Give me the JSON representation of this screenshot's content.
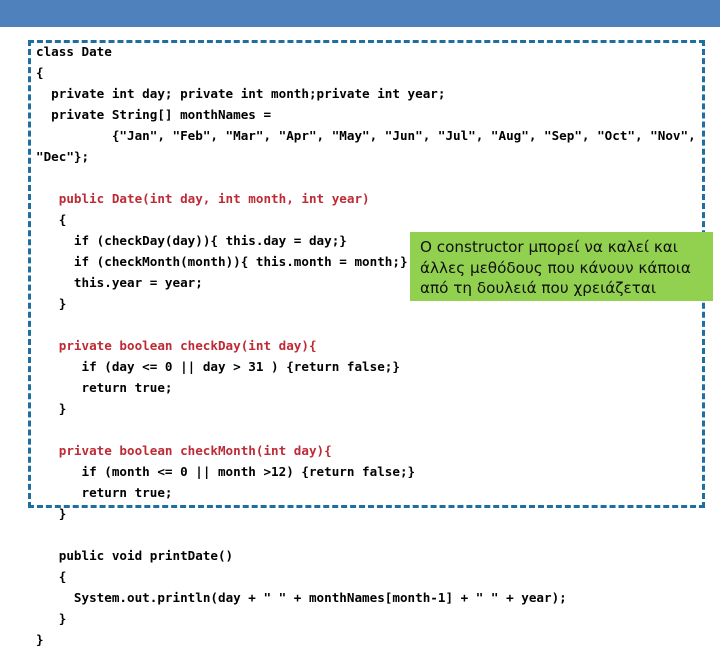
{
  "slide": {
    "banner_color": "#4F81BD",
    "background_color": "#FFFFFF",
    "border_color": "#1E6FA0",
    "keyword_color": "#BE2A35",
    "callout_color": "#92D050"
  },
  "code": {
    "language": "java",
    "lines": [
      {
        "indent": 0,
        "segments": [
          {
            "text": "class Date",
            "kw": false
          }
        ]
      },
      {
        "indent": 0,
        "segments": [
          {
            "text": "{",
            "kw": false
          }
        ]
      },
      {
        "indent": 0,
        "segments": [
          {
            "text": "  private int day; private int month;private int year;",
            "kw": false
          }
        ]
      },
      {
        "indent": 0,
        "segments": [
          {
            "text": "  private String[] monthNames = ",
            "kw": false
          }
        ]
      },
      {
        "indent": 0,
        "segments": [
          {
            "text": "          {\"Jan\", \"Feb\", \"Mar\", \"Apr\", \"May\", \"Jun\", \"Jul\", \"Aug\", \"Sep\", \"Oct\", \"Nov\", \"Dec\"};",
            "kw": false
          }
        ]
      },
      {
        "indent": 0,
        "segments": []
      },
      {
        "indent": 0,
        "segments": [
          {
            "text": "   public Date(int day, int month, int year)",
            "kw": true
          }
        ]
      },
      {
        "indent": 0,
        "segments": [
          {
            "text": "   {",
            "kw": false
          }
        ]
      },
      {
        "indent": 0,
        "segments": [
          {
            "text": "     if (checkDay(day)){ this.day = day;}",
            "kw": false
          }
        ]
      },
      {
        "indent": 0,
        "segments": [
          {
            "text": "     if (checkMonth(month)){ this.month = month;}",
            "kw": false
          }
        ]
      },
      {
        "indent": 0,
        "segments": [
          {
            "text": "     this.year = year;",
            "kw": false
          }
        ]
      },
      {
        "indent": 0,
        "segments": [
          {
            "text": "   }",
            "kw": false
          }
        ]
      },
      {
        "indent": 0,
        "segments": []
      },
      {
        "indent": 0,
        "segments": [
          {
            "text": "   private boolean checkDay(int day){",
            "kw": true
          }
        ]
      },
      {
        "indent": 0,
        "segments": [
          {
            "text": "      if (day <= 0 || day > 31 ) {return false;}",
            "kw": false
          }
        ]
      },
      {
        "indent": 0,
        "segments": [
          {
            "text": "      return true;",
            "kw": false
          }
        ]
      },
      {
        "indent": 0,
        "segments": [
          {
            "text": "   }",
            "kw": false
          }
        ]
      },
      {
        "indent": 0,
        "segments": []
      },
      {
        "indent": 0,
        "segments": [
          {
            "text": "   private boolean checkMonth(int day){",
            "kw": true
          }
        ]
      },
      {
        "indent": 0,
        "segments": [
          {
            "text": "      if (month <= 0 || month >12) {return false;}",
            "kw": false
          }
        ]
      },
      {
        "indent": 0,
        "segments": [
          {
            "text": "      return true;",
            "kw": false
          }
        ]
      },
      {
        "indent": 0,
        "segments": [
          {
            "text": "   }",
            "kw": false
          }
        ]
      },
      {
        "indent": 0,
        "segments": []
      },
      {
        "indent": 0,
        "segments": [
          {
            "text": "   public void printDate()",
            "kw": false
          }
        ]
      },
      {
        "indent": 0,
        "segments": [
          {
            "text": "   {",
            "kw": false
          }
        ]
      },
      {
        "indent": 0,
        "segments": [
          {
            "text": "     System.out.println(day + \" \" + monthNames[month-1] + \" \" + year);",
            "kw": false
          }
        ]
      },
      {
        "indent": 0,
        "segments": [
          {
            "text": "   }",
            "kw": false
          }
        ]
      },
      {
        "indent": 0,
        "segments": [
          {
            "text": "}",
            "kw": false
          }
        ]
      }
    ]
  },
  "callout": {
    "lines": [
      "Ο constructor μπορεί να καλεί και",
      "άλλες μεθόδους που κάνουν κάποια",
      "από τη δουλειά που χρειάζεται"
    ]
  }
}
